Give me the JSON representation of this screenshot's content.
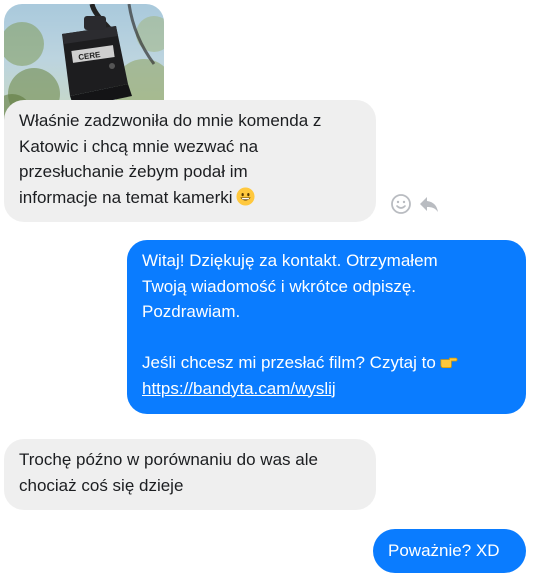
{
  "conversation": {
    "attachment": {
      "kind": "photo",
      "description_icon": "dashcam-photo"
    },
    "messages": [
      {
        "direction": "incoming",
        "lines": [
          "Właśnie zadzwoniła do mnie komenda z",
          "Katowic i chcą mnie wezwać na",
          "przesłuchanie żebym podał im",
          "informacje na temat kamerki"
        ],
        "emoji": "grinning-face-emoji"
      },
      {
        "direction": "outgoing",
        "lines": [
          "Witaj! Dziękuję za kontakt. Otrzymałem",
          "Twoją wiadomość i wkrótce odpiszę.",
          "Pozdrawiam."
        ],
        "line4": "Jeśli chcesz mi przesłać film? Czytaj to",
        "emoji": "pointing-right-emoji",
        "link": "https://bandyta.cam/wyslij"
      },
      {
        "direction": "incoming",
        "lines": [
          "Trochę późno w porównaniu do was ale",
          "chociaż coś się dzieje"
        ]
      },
      {
        "direction": "outgoing",
        "text": "Poważnie? XD"
      }
    ],
    "message_actions": {
      "react_icon": "smiley-icon",
      "reply_icon": "reply-icon"
    }
  },
  "colors": {
    "incoming_bg": "#efefef",
    "incoming_text": "#1c1e21",
    "outgoing_bg": "#0a7cff",
    "outgoing_text": "#ffffff",
    "action_icon": "#b9bcc1"
  },
  "photo_text": {
    "brand": "CERE"
  }
}
